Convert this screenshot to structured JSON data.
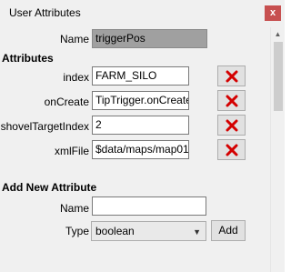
{
  "window": {
    "title": "User Attributes",
    "close_glyph": "x"
  },
  "name_row": {
    "label": "Name",
    "value": "triggerPos"
  },
  "attributes": {
    "heading": "Attributes",
    "rows": [
      {
        "label": "index",
        "value": "FARM_SILO"
      },
      {
        "label": "onCreate",
        "value": "TipTrigger.onCreate"
      },
      {
        "label": "shovelTargetIndex",
        "value": "2"
      },
      {
        "label": "xmlFile",
        "value": "$data/maps/map01"
      }
    ]
  },
  "add_new": {
    "heading": "Add New Attribute",
    "name_label": "Name",
    "name_value": "",
    "type_label": "Type",
    "type_value": "boolean",
    "add_label": "Add"
  },
  "colors": {
    "delete_icon": "#d40000",
    "close_button": "#c75050"
  }
}
